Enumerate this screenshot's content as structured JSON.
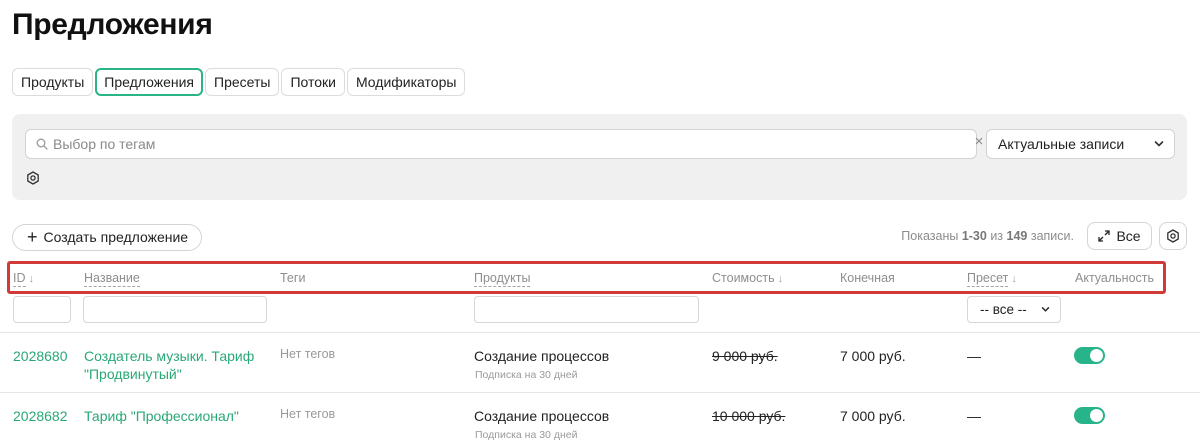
{
  "page": {
    "title": "Предложения"
  },
  "tabs": [
    {
      "label": "Продукты",
      "active": false
    },
    {
      "label": "Предложения",
      "active": true
    },
    {
      "label": "Пресеты",
      "active": false
    },
    {
      "label": "Потоки",
      "active": false
    },
    {
      "label": "Модификаторы",
      "active": false
    }
  ],
  "filters": {
    "tag_search_placeholder": "Выбор по тегам",
    "tag_search_value": "",
    "status_selected": "Актуальные записи",
    "clear_symbol": "×"
  },
  "toolbar": {
    "create_label": "Создать предложение",
    "create_symbol": "+",
    "records_prefix": "Показаны ",
    "records_range": "1-30",
    "records_middle": " из ",
    "records_total": "149",
    "records_suffix": " записи.",
    "expand_label": "Все"
  },
  "table": {
    "columns": {
      "id": "ID",
      "name": "Название",
      "tags": "Теги",
      "products": "Продукты",
      "price": "Стоимость",
      "final": "Конечная",
      "preset": "Пресет",
      "active": "Актуальность"
    },
    "sort_arrow": "↓",
    "preset_filter_selected": "-- все --",
    "rows": [
      {
        "id": "2028680",
        "name_line1": "Создатель музыки. Тариф",
        "name_line2": "\"Продвинутый\"",
        "tags": "Нет тегов",
        "product": "Создание процессов",
        "product_sub": "Подписка на 30 дней",
        "price": "9 000 руб.",
        "final": "7 000 руб.",
        "preset": "—",
        "active": true
      },
      {
        "id": "2028682",
        "name_line1": "Тариф \"Профессионал\"",
        "name_line2": "",
        "tags": "Нет тегов",
        "product": "Создание процессов",
        "product_sub": "Подписка на 30 дней",
        "price": "10 000 руб.",
        "final": "7 000 руб.",
        "preset": "—",
        "active": true
      }
    ]
  },
  "colors": {
    "accent": "#2bb585",
    "link": "#2aa876",
    "highlight": "#d23a3a",
    "panel_bg": "#f0f0f0"
  },
  "icons": {
    "search": "search-icon",
    "chevron": "chevron-down-icon",
    "settings": "settings-hexagon-icon",
    "expand": "expand-arrows-icon",
    "plus": "plus-icon",
    "close": "close-icon"
  }
}
